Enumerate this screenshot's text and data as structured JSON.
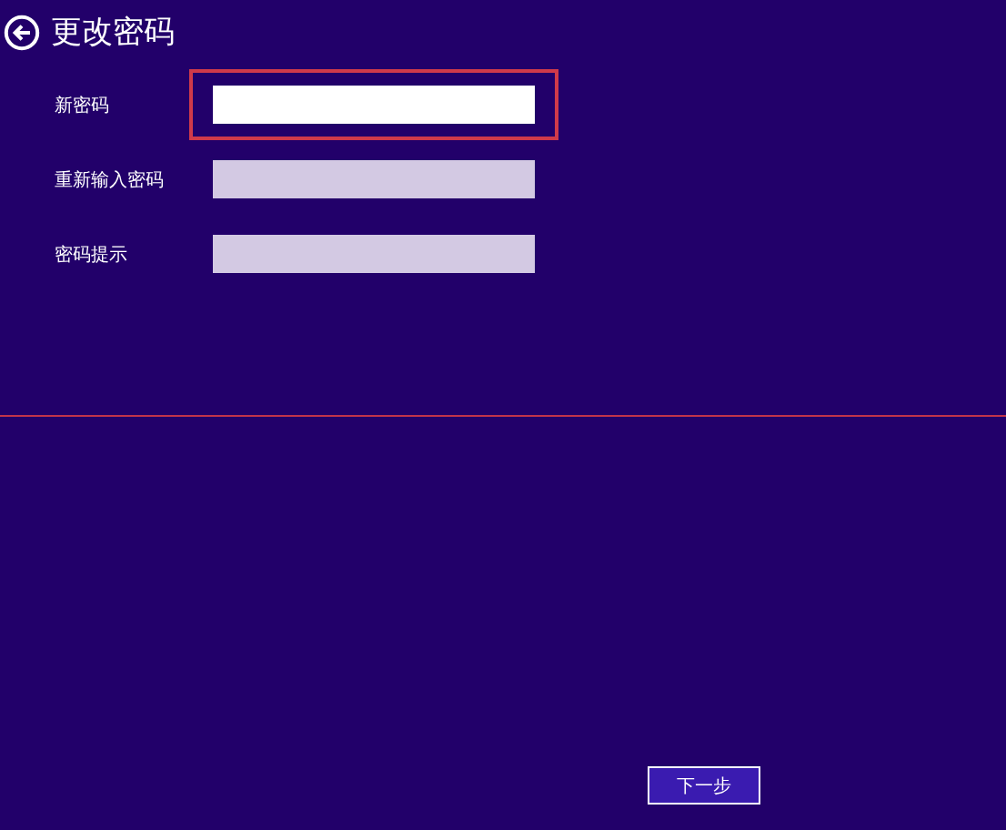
{
  "title": "更改密码",
  "fields": [
    {
      "label": "新密码",
      "focused": true
    },
    {
      "label": "重新输入密码",
      "focused": false
    },
    {
      "label": "密码提示",
      "focused": false
    }
  ],
  "buttons": [
    {
      "label": "下一步"
    }
  ]
}
